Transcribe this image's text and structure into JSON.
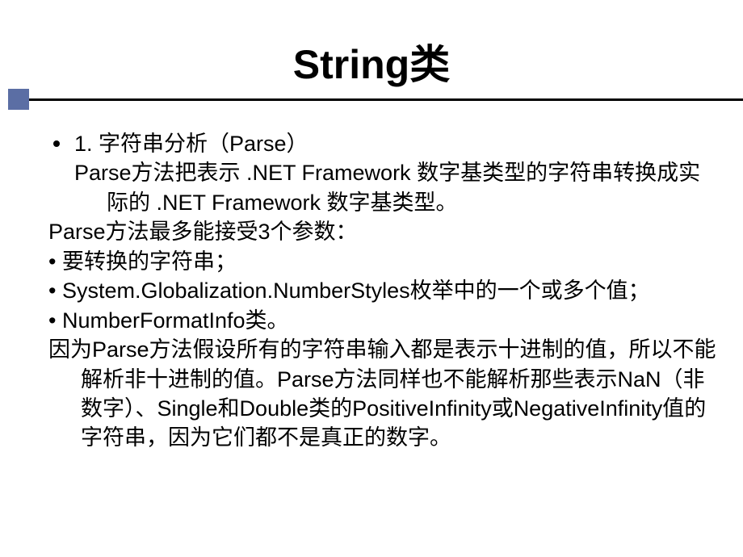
{
  "title": "String类",
  "body": {
    "item1_line1": "1. 字符串分析（Parse）",
    "item1_line2": "Parse方法把表示 .NET Framework 数字基类型的字符串转换成实际的 .NET Framework  数字基类型。",
    "para_parse_params": "Parse方法最多能接受3个参数：",
    "bullet_param1": "• 要转换的字符串；",
    "bullet_param2": "• System.Globalization.NumberStyles枚举中的一个或多个值；",
    "bullet_param3": "• NumberFormatInfo类。",
    "final_para": "因为Parse方法假设所有的字符串输入都是表示十进制的值，所以不能解析非十进制的值。Parse方法同样也不能解析那些表示NaN（非数字）、Single和Double类的PositiveInfinity或NegativeInfinity值的字符串，因为它们都不是真正的数字。"
  }
}
